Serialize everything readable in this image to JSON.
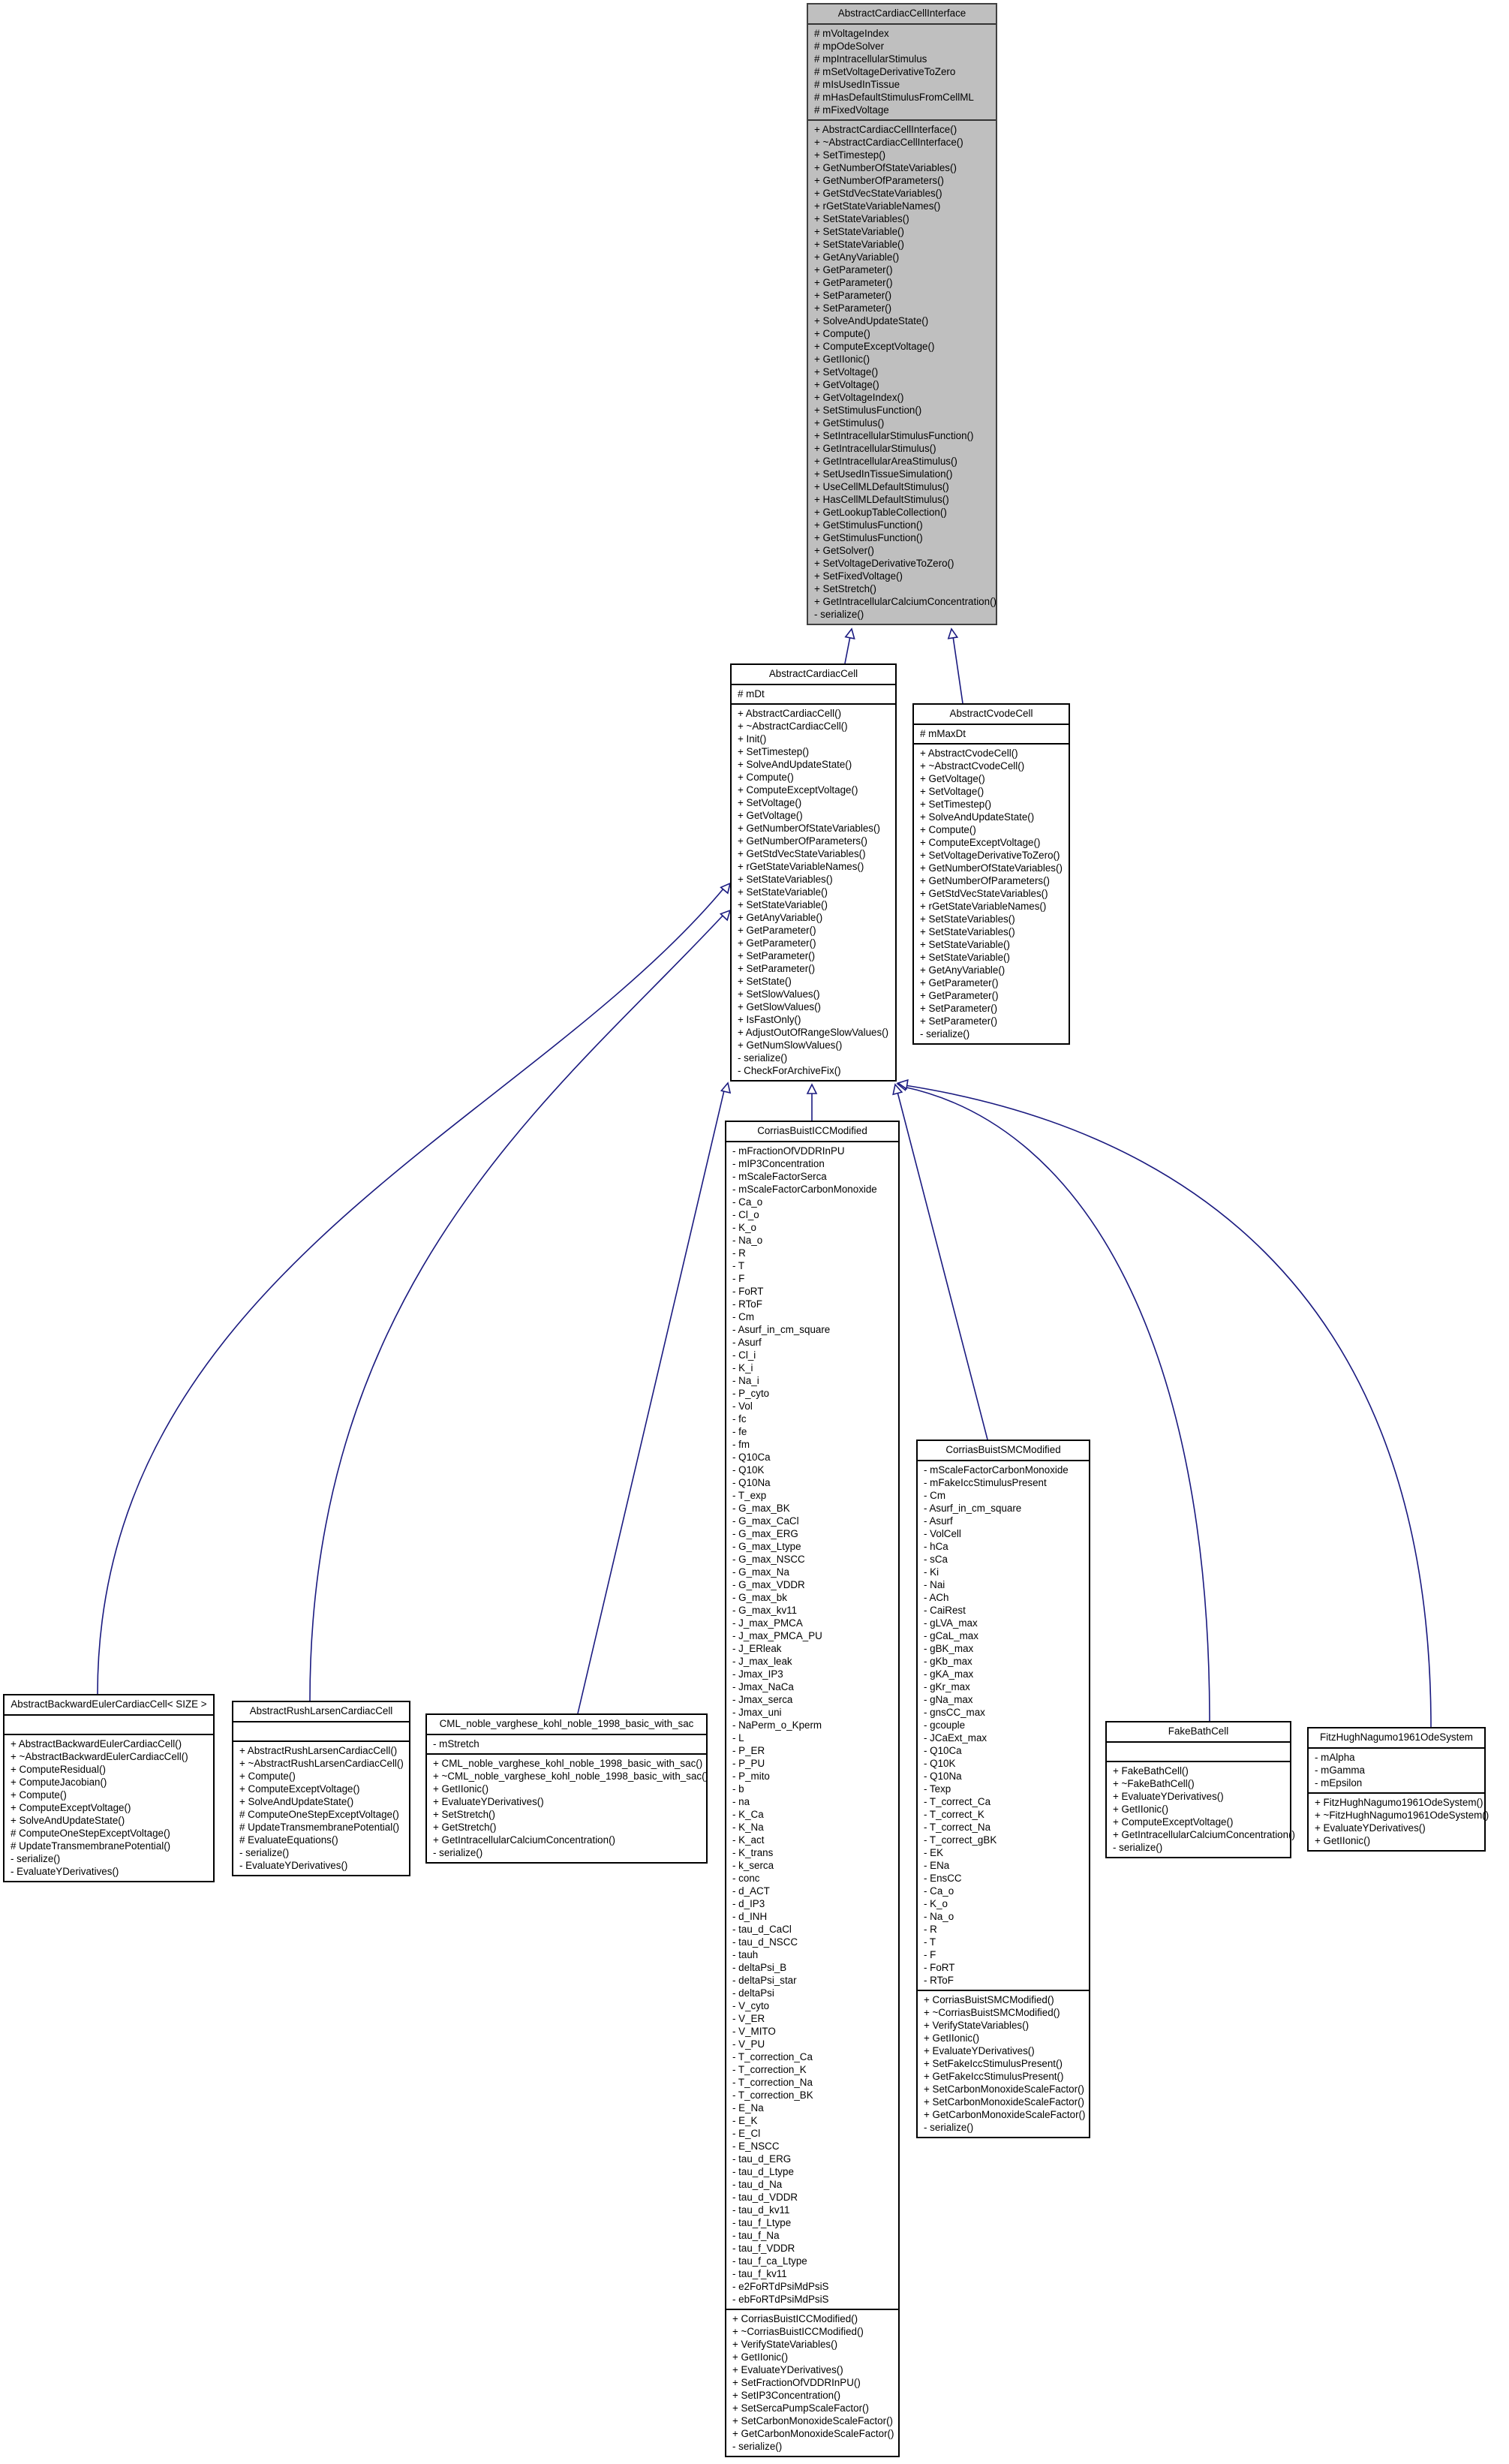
{
  "diagram": {
    "type": "class-inheritance",
    "edge_color": "#1a1a80",
    "base_fill": "#bfbfbf",
    "classes": {
      "acci": {
        "name": "AbstractCardiacCellInterface",
        "attributes": [
          "# mVoltageIndex",
          "# mpOdeSolver",
          "# mpIntracellularStimulus",
          "# mSetVoltageDerivativeToZero",
          "# mIsUsedInTissue",
          "# mHasDefaultStimulusFromCellML",
          "# mFixedVoltage"
        ],
        "methods": [
          "+ AbstractCardiacCellInterface()",
          "+ ~AbstractCardiacCellInterface()",
          "+ SetTimestep()",
          "+ GetNumberOfStateVariables()",
          "+ GetNumberOfParameters()",
          "+ GetStdVecStateVariables()",
          "+ rGetStateVariableNames()",
          "+ SetStateVariables()",
          "+ SetStateVariable()",
          "+ SetStateVariable()",
          "+ GetAnyVariable()",
          "+ GetParameter()",
          "+ GetParameter()",
          "+ SetParameter()",
          "+ SetParameter()",
          "+ SolveAndUpdateState()",
          "+ Compute()",
          "+ ComputeExceptVoltage()",
          "+ GetIIonic()",
          "+ SetVoltage()",
          "+ GetVoltage()",
          "+ GetVoltageIndex()",
          "+ SetStimulusFunction()",
          "+ GetStimulus()",
          "+ SetIntracellularStimulusFunction()",
          "+ GetIntracellularStimulus()",
          "+ GetIntracellularAreaStimulus()",
          "+ SetUsedInTissueSimulation()",
          "+ UseCellMLDefaultStimulus()",
          "+ HasCellMLDefaultStimulus()",
          "+ GetLookupTableCollection()",
          "+ GetStimulusFunction()",
          "+ GetStimulusFunction()",
          "+ GetSolver()",
          "+ SetVoltageDerivativeToZero()",
          "+ SetFixedVoltage()",
          "+ SetStretch()",
          "+ GetIntracellularCalciumConcentration()",
          "- serialize()"
        ]
      },
      "acc": {
        "name": "AbstractCardiacCell",
        "attributes": [
          "# mDt"
        ],
        "methods": [
          "+ AbstractCardiacCell()",
          "+ ~AbstractCardiacCell()",
          "+ Init()",
          "+ SetTimestep()",
          "+ SolveAndUpdateState()",
          "+ Compute()",
          "+ ComputeExceptVoltage()",
          "+ SetVoltage()",
          "+ GetVoltage()",
          "+ GetNumberOfStateVariables()",
          "+ GetNumberOfParameters()",
          "+ GetStdVecStateVariables()",
          "+ rGetStateVariableNames()",
          "+ SetStateVariables()",
          "+ SetStateVariable()",
          "+ SetStateVariable()",
          "+ GetAnyVariable()",
          "+ GetParameter()",
          "+ GetParameter()",
          "+ SetParameter()",
          "+ SetParameter()",
          "+ SetState()",
          "+ SetSlowValues()",
          "+ GetSlowValues()",
          "+ IsFastOnly()",
          "+ AdjustOutOfRangeSlowValues()",
          "+ GetNumSlowValues()",
          "- serialize()",
          "- CheckForArchiveFix()"
        ]
      },
      "acvc": {
        "name": "AbstractCvodeCell",
        "attributes": [
          "# mMaxDt"
        ],
        "methods": [
          "+ AbstractCvodeCell()",
          "+ ~AbstractCvodeCell()",
          "+ GetVoltage()",
          "+ SetVoltage()",
          "+ SetTimestep()",
          "+ SolveAndUpdateState()",
          "+ Compute()",
          "+ ComputeExceptVoltage()",
          "+ SetVoltageDerivativeToZero()",
          "+ GetNumberOfStateVariables()",
          "+ GetNumberOfParameters()",
          "+ GetStdVecStateVariables()",
          "+ rGetStateVariableNames()",
          "+ SetStateVariables()",
          "+ SetStateVariables()",
          "+ SetStateVariable()",
          "+ SetStateVariable()",
          "+ GetAnyVariable()",
          "+ GetParameter()",
          "+ GetParameter()",
          "+ SetParameter()",
          "+ SetParameter()",
          "- serialize()"
        ]
      },
      "cbicc": {
        "name": "CorriasBuistICCModified",
        "attributes": [
          "- mFractionOfVDDRInPU",
          "- mIP3Concentration",
          "- mScaleFactorSerca",
          "- mScaleFactorCarbonMonoxide",
          "- Ca_o",
          "- Cl_o",
          "- K_o",
          "- Na_o",
          "- R",
          "- T",
          "- F",
          "- FoRT",
          "- RToF",
          "- Cm",
          "- Asurf_in_cm_square",
          "- Asurf",
          "- Cl_i",
          "- K_i",
          "- Na_i",
          "- P_cyto",
          "- Vol",
          "- fc",
          "- fe",
          "- fm",
          "- Q10Ca",
          "- Q10K",
          "- Q10Na",
          "- T_exp",
          "- G_max_BK",
          "- G_max_CaCl",
          "- G_max_ERG",
          "- G_max_Ltype",
          "- G_max_NSCC",
          "- G_max_Na",
          "- G_max_VDDR",
          "- G_max_bk",
          "- G_max_kv11",
          "- J_max_PMCA",
          "- J_max_PMCA_PU",
          "- J_ERleak",
          "- J_max_leak",
          "- Jmax_IP3",
          "- Jmax_NaCa",
          "- Jmax_serca",
          "- Jmax_uni",
          "- NaPerm_o_Kperm",
          "- L",
          "- P_ER",
          "- P_PU",
          "- P_mito",
          "- b",
          "- na",
          "- K_Ca",
          "- K_Na",
          "- K_act",
          "- K_trans",
          "- k_serca",
          "- conc",
          "- d_ACT",
          "- d_IP3",
          "- d_INH",
          "- tau_d_CaCl",
          "- tau_d_NSCC",
          "- tauh",
          "- deltaPsi_B",
          "- deltaPsi_star",
          "- deltaPsi",
          "- V_cyto",
          "- V_ER",
          "- V_MITO",
          "- V_PU",
          "- T_correction_Ca",
          "- T_correction_K",
          "- T_correction_Na",
          "- T_correction_BK",
          "- E_Na",
          "- E_K",
          "- E_Cl",
          "- E_NSCC",
          "- tau_d_ERG",
          "- tau_d_Ltype",
          "- tau_d_Na",
          "- tau_d_VDDR",
          "- tau_d_kv11",
          "- tau_f_Ltype",
          "- tau_f_Na",
          "- tau_f_VDDR",
          "- tau_f_ca_Ltype",
          "- tau_f_kv11",
          "- e2FoRTdPsiMdPsiS",
          "- ebFoRTdPsiMdPsiS"
        ],
        "methods": [
          "+ CorriasBuistICCModified()",
          "+ ~CorriasBuistICCModified()",
          "+ VerifyStateVariables()",
          "+ GetIIonic()",
          "+ EvaluateYDerivatives()",
          "+ SetFractionOfVDDRInPU()",
          "+ SetIP3Concentration()",
          "+ SetSercaPumpScaleFactor()",
          "+ SetCarbonMonoxideScaleFactor()",
          "+ GetCarbonMonoxideScaleFactor()",
          "- serialize()"
        ]
      },
      "cbsmc": {
        "name": "CorriasBuistSMCModified",
        "attributes": [
          "- mScaleFactorCarbonMonoxide",
          "- mFakeIccStimulusPresent",
          "- Cm",
          "- Asurf_in_cm_square",
          "- Asurf",
          "- VolCell",
          "- hCa",
          "- sCa",
          "- Ki",
          "- Nai",
          "- ACh",
          "- CaiRest",
          "- gLVA_max",
          "- gCaL_max",
          "- gBK_max",
          "- gKb_max",
          "- gKA_max",
          "- gKr_max",
          "- gNa_max",
          "- gnsCC_max",
          "- gcouple",
          "- JCaExt_max",
          "- Q10Ca",
          "- Q10K",
          "- Q10Na",
          "- Texp",
          "- T_correct_Ca",
          "- T_correct_K",
          "- T_correct_Na",
          "- T_correct_gBK",
          "- EK",
          "- ENa",
          "- EnsCC",
          "- Ca_o",
          "- K_o",
          "- Na_o",
          "- R",
          "- T",
          "- F",
          "- FoRT",
          "- RToF"
        ],
        "methods": [
          "+ CorriasBuistSMCModified()",
          "+ ~CorriasBuistSMCModified()",
          "+ VerifyStateVariables()",
          "+ GetIIonic()",
          "+ EvaluateYDerivatives()",
          "+ SetFakeIccStimulusPresent()",
          "+ GetFakeIccStimulusPresent()",
          "+ SetCarbonMonoxideScaleFactor()",
          "+ SetCarbonMonoxideScaleFactor()",
          "+ GetCarbonMonoxideScaleFactor()",
          "- serialize()"
        ]
      },
      "abe": {
        "name": "AbstractBackwardEulerCardiacCell< SIZE >",
        "attributes": [],
        "methods": [
          "+ AbstractBackwardEulerCardiacCell()",
          "+ ~AbstractBackwardEulerCardiacCell()",
          "+ ComputeResidual()",
          "+ ComputeJacobian()",
          "+ Compute()",
          "+ ComputeExceptVoltage()",
          "+ SolveAndUpdateState()",
          "# ComputeOneStepExceptVoltage()",
          "# UpdateTransmembranePotential()",
          "- serialize()",
          "- EvaluateYDerivatives()"
        ]
      },
      "arl": {
        "name": "AbstractRushLarsenCardiacCell",
        "attributes": [],
        "methods": [
          "+ AbstractRushLarsenCardiacCell()",
          "+ ~AbstractRushLarsenCardiacCell()",
          "+ Compute()",
          "+ ComputeExceptVoltage()",
          "+ SolveAndUpdateState()",
          "# ComputeOneStepExceptVoltage()",
          "# UpdateTransmembranePotential()",
          "# EvaluateEquations()",
          "- serialize()",
          "- EvaluateYDerivatives()"
        ]
      },
      "cml": {
        "name": "CML_noble_varghese_kohl_noble_1998_basic_with_sac",
        "attributes": [
          "- mStretch"
        ],
        "methods": [
          "+ CML_noble_varghese_kohl_noble_1998_basic_with_sac()",
          "+ ~CML_noble_varghese_kohl_noble_1998_basic_with_sac()",
          "+ GetIIonic()",
          "+ EvaluateYDerivatives()",
          "+ SetStretch()",
          "+ GetStretch()",
          "+ GetIntracellularCalciumConcentration()",
          "- serialize()"
        ]
      },
      "fbc": {
        "name": "FakeBathCell",
        "attributes": [],
        "methods": [
          "+ FakeBathCell()",
          "+ ~FakeBathCell()",
          "+ EvaluateYDerivatives()",
          "+ GetIIonic()",
          "+ ComputeExceptVoltage()",
          "+ GetIntracellularCalciumConcentration()",
          "- serialize()"
        ]
      },
      "fhn": {
        "name": "FitzHughNagumo1961OdeSystem",
        "attributes": [
          "- mAlpha",
          "- mGamma",
          "- mEpsilon"
        ],
        "methods": [
          "+ FitzHughNagumo1961OdeSystem()",
          "+ ~FitzHughNagumo1961OdeSystem()",
          "+ EvaluateYDerivatives()",
          "+ GetIIonic()"
        ]
      }
    },
    "inheritance": [
      {
        "child": "acc",
        "parent": "acci"
      },
      {
        "child": "acvc",
        "parent": "acci"
      },
      {
        "child": "abe",
        "parent": "acc"
      },
      {
        "child": "arl",
        "parent": "acc"
      },
      {
        "child": "cml",
        "parent": "acc"
      },
      {
        "child": "cbicc",
        "parent": "acc"
      },
      {
        "child": "cbsmc",
        "parent": "acc"
      },
      {
        "child": "fbc",
        "parent": "acc"
      },
      {
        "child": "fhn",
        "parent": "acc"
      }
    ]
  }
}
